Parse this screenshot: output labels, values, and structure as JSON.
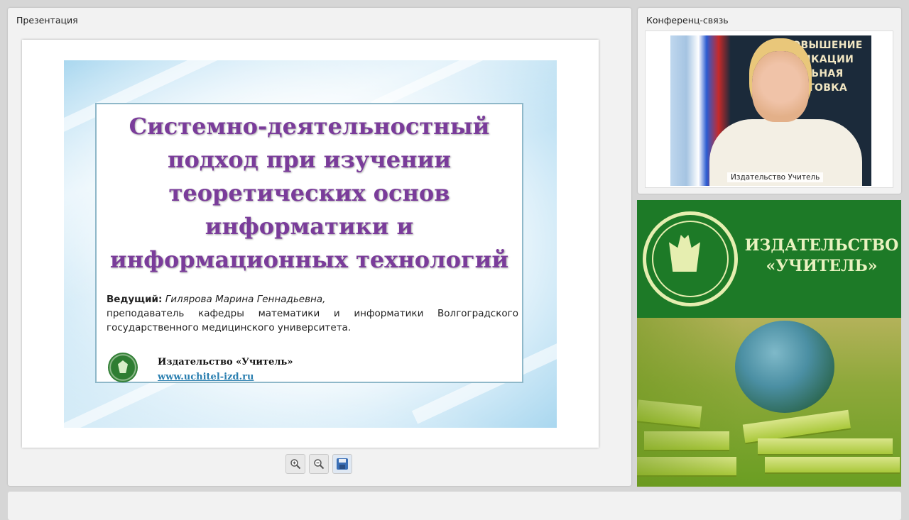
{
  "presentation_panel": {
    "title": "Презентация",
    "slide": {
      "heading_lines": [
        "Системно-деятельностный",
        "подход при изучении",
        "теоретических основ",
        "информатики и",
        "информационных технологий"
      ],
      "presenter_label": "Ведущий:",
      "presenter_name": "Гилярова Марина Геннадьевна,",
      "presenter_position": "преподаватель кафедры математики и информатики Волгоградского государственного медицинского университета.",
      "publisher_name": "Издательство «Учитель»",
      "publisher_url": "www.uchitel-izd.ru"
    },
    "toolbar": {
      "zoom_in_icon": "zoom-in-icon",
      "zoom_out_icon": "zoom-out-icon",
      "save_icon": "save-icon"
    }
  },
  "conference_panel": {
    "title": "Конференц-связь",
    "video": {
      "banner_lines": [
        "ПОВЫШЕНИЕ",
        "ФИКАЦИИ",
        "ЛЬНАЯ",
        "ОТОВКА"
      ],
      "caption": "Издательство Учитель"
    }
  },
  "advertisement": {
    "line1": "ИЗДАТЕЛЬСТВО",
    "line2": "«УЧИТЕЛЬ»"
  },
  "colors": {
    "heading": "#7a3c9a",
    "ad_green": "#1d7a27",
    "ad_text": "#e9f2c0",
    "link": "#2a7fb0"
  }
}
